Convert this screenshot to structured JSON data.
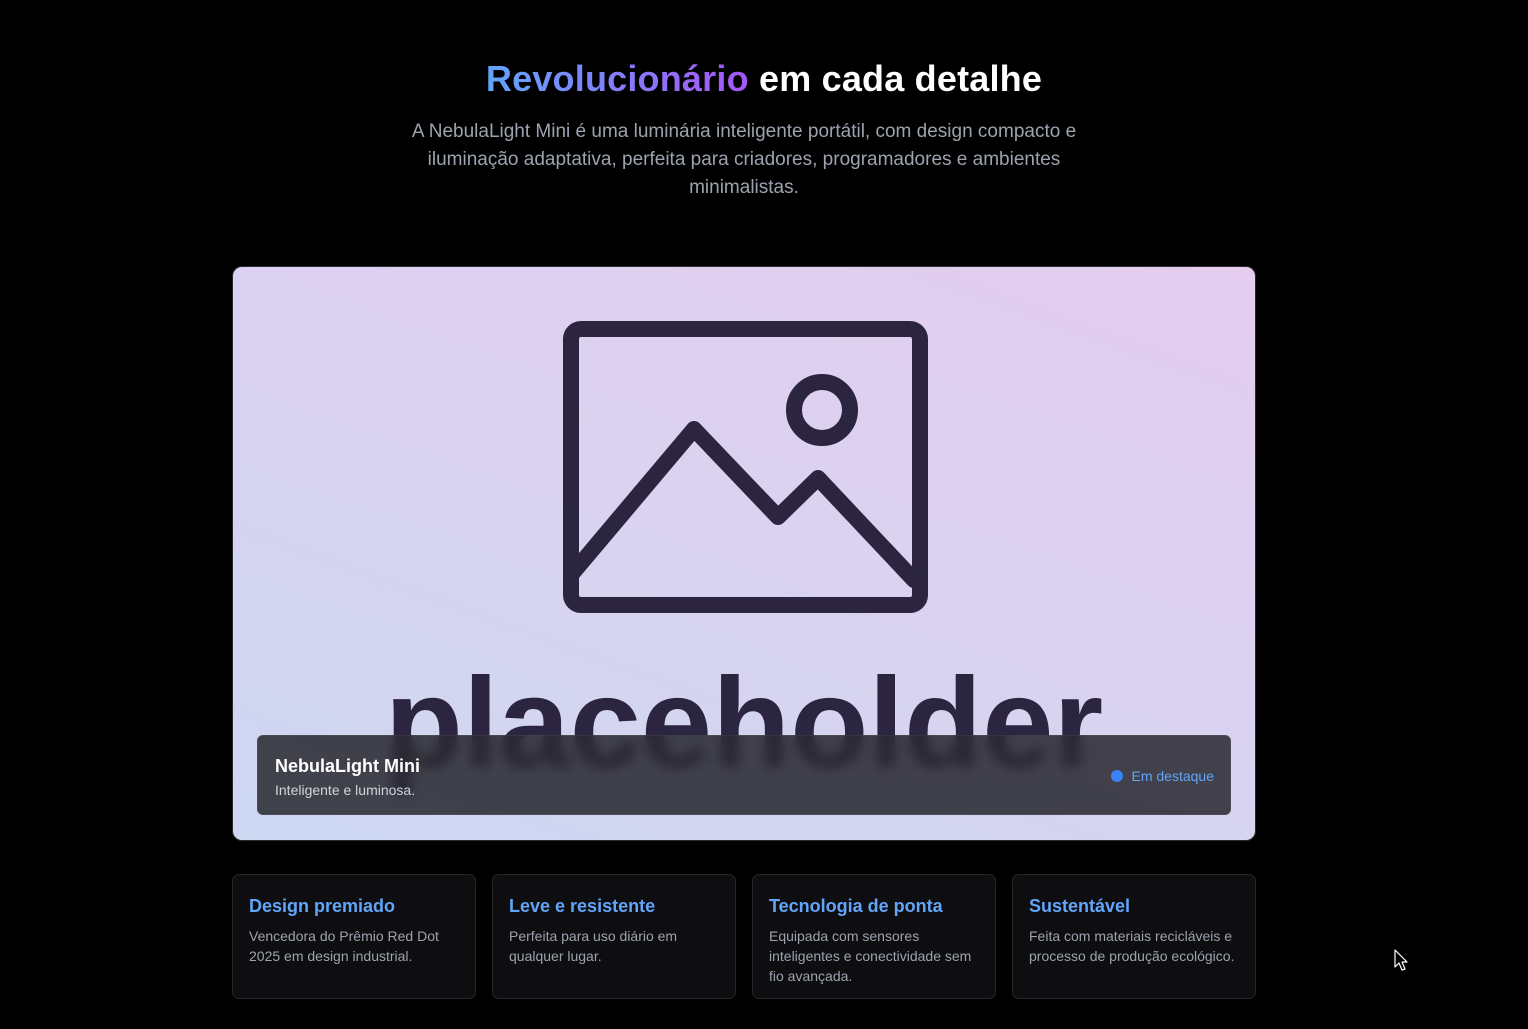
{
  "hero": {
    "title_highlight": "Revolucionário",
    "title_rest": " em cada detalhe",
    "description": "A NebulaLight Mini é uma luminária inteligente portátil, com design compacto e iluminação adaptativa, perfeita para criadores, programadores e ambientes minimalistas."
  },
  "showcase": {
    "image_icon": "image-placeholder-icon",
    "image_text": "placeholder",
    "product_name": "NebulaLight Mini",
    "product_tagline": "Inteligente e luminosa.",
    "badge_label": "Em destaque",
    "badge_color": "#3b82f6"
  },
  "features": [
    {
      "title": "Design premiado",
      "text": "Vencedora do Prêmio Red Dot 2025 em design industrial."
    },
    {
      "title": "Leve e resistente",
      "text": "Perfeita para uso diário em qualquer lugar."
    },
    {
      "title": "Tecnologia de ponta",
      "text": "Equipada com sensores inteligentes e conectividade sem fio avançada."
    },
    {
      "title": "Sustentável",
      "text": "Feita com materiais recicláveis e processo de produção ecológico."
    }
  ],
  "colors": {
    "background": "#000000",
    "accent_blue": "#60a5fa",
    "accent_purple": "#a855f7",
    "muted_text": "#9ca3af"
  },
  "cursor_icon": "mouse-pointer-icon"
}
